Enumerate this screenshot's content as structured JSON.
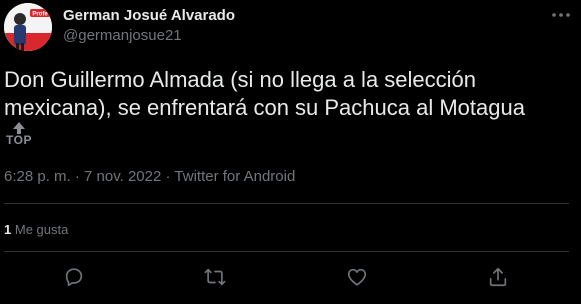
{
  "tweet": {
    "author_name": "German Josué Alvarado",
    "author_handle": "@germanjosue21",
    "text": "Don Guillermo Almada (si no llega a la selección mexicana), se enfrentará con su Pachuca al Motagua",
    "time": "6:28 p. m.",
    "separator": "·",
    "date": "7 nov. 2022",
    "source": "Twitter for Android",
    "likes_count": "1",
    "likes_label": "Me gusta"
  },
  "avatar": {
    "badge_text": "Profe"
  },
  "top_widget": {
    "label": "TOP"
  },
  "icons": {
    "more": "more-horizontal-icon",
    "reply": "reply-icon",
    "retweet": "retweet-icon",
    "like": "heart-icon",
    "share": "share-icon",
    "top_arrow": "arrow-up-icon"
  },
  "colors": {
    "background": "#000000",
    "primary_text": "#e7e9ea",
    "secondary_text": "#71767b",
    "divider": "#2f3336",
    "avatar_red": "#d8282e"
  }
}
